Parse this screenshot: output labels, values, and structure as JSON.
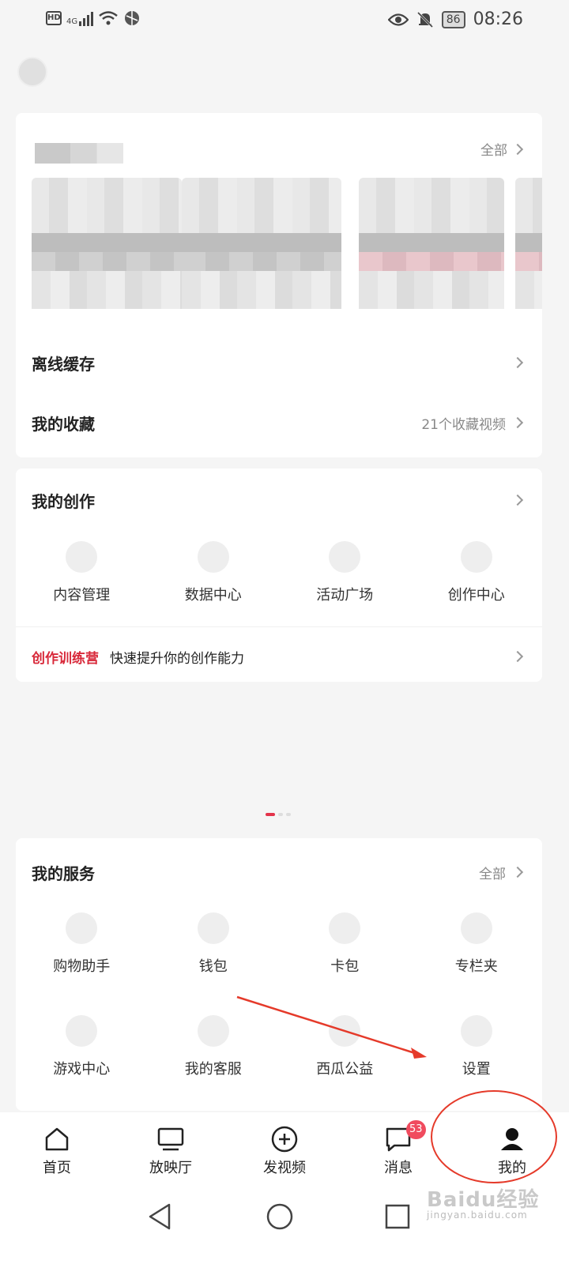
{
  "status_bar": {
    "hd": "HD",
    "network": "4G",
    "battery": "86",
    "time": "08:26"
  },
  "history": {
    "more": "全部"
  },
  "list_rows": [
    {
      "title": "离线缓存",
      "right": ""
    },
    {
      "title": "我的收藏",
      "right": "21个收藏视频"
    }
  ],
  "creation": {
    "title": "我的创作",
    "items": [
      "内容管理",
      "数据中心",
      "活动广场",
      "创作中心"
    ],
    "camp_tag": "创作训练营",
    "camp_text": "快速提升你的创作能力"
  },
  "services": {
    "title": "我的服务",
    "more": "全部",
    "row1": [
      "购物助手",
      "钱包",
      "卡包",
      "专栏夹"
    ],
    "row2": [
      "游戏中心",
      "我的客服",
      "西瓜公益",
      "设置"
    ]
  },
  "bottom_nav": [
    {
      "label": "首页",
      "icon": "home-icon"
    },
    {
      "label": "放映厅",
      "icon": "tv-icon"
    },
    {
      "label": "发视频",
      "icon": "plus-circle-icon"
    },
    {
      "label": "消息",
      "icon": "message-icon",
      "badge": "53"
    },
    {
      "label": "我的",
      "icon": "person-icon"
    }
  ],
  "watermark": {
    "brand": "Baidu经验",
    "url": "jingyan.baidu.com"
  },
  "colors": {
    "accent": "#d8293a",
    "badge": "#f04b5e",
    "annotation": "#e53a2a"
  }
}
